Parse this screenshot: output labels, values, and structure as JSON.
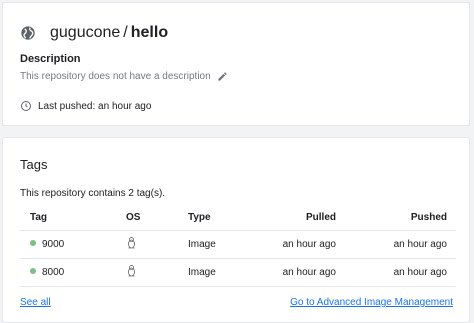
{
  "repo": {
    "namespace": "gugucone",
    "separator": "/",
    "name": "hello",
    "description_label": "Description",
    "description_text": "This repository does not have a description",
    "last_pushed": "Last pushed: an hour ago"
  },
  "tags": {
    "title": "Tags",
    "summary": "This repository contains 2 tag(s).",
    "columns": {
      "tag": "Tag",
      "os": "OS",
      "type": "Type",
      "pulled": "Pulled",
      "pushed": "Pushed"
    },
    "rows": [
      {
        "tag": "9000",
        "os": "linux-icon",
        "type": "Image",
        "pulled": "an hour ago",
        "pushed": "an hour ago"
      },
      {
        "tag": "8000",
        "os": "linux-icon",
        "type": "Image",
        "pulled": "an hour ago",
        "pushed": "an hour ago"
      }
    ],
    "see_all": "See all",
    "advanced_link": "Go to Advanced Image Management"
  },
  "colors": {
    "accent": "#1a73e8",
    "status_dot": "#7fbf85",
    "muted": "#757a80"
  }
}
